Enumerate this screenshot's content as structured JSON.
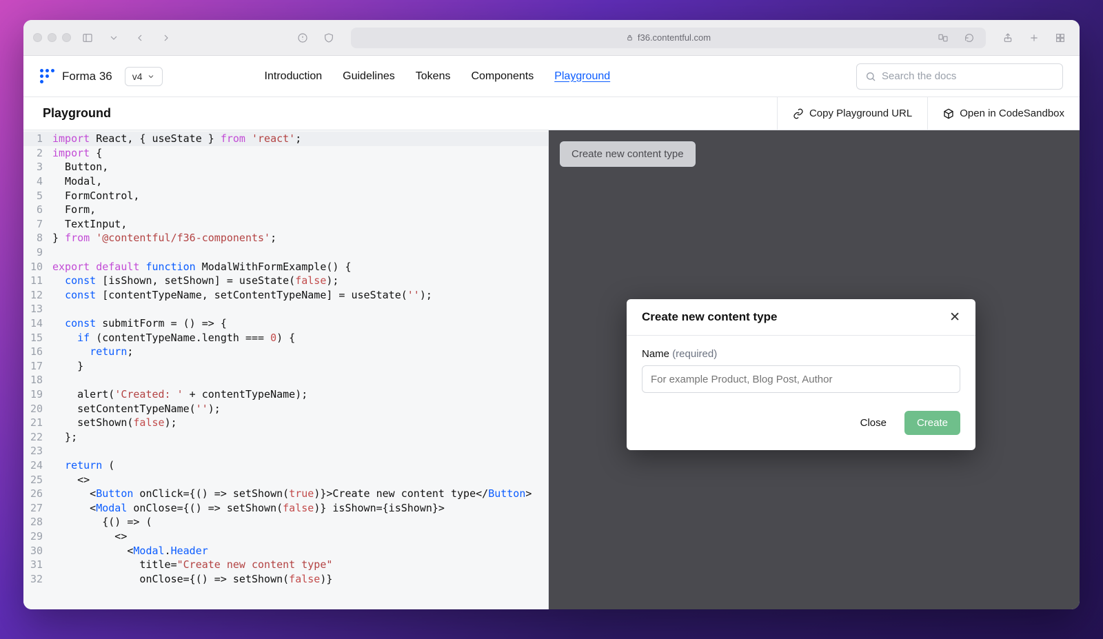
{
  "browser": {
    "address": "f36.contentful.com"
  },
  "header": {
    "brand": "Forma 36",
    "version": "v4",
    "nav": {
      "introduction": "Introduction",
      "guidelines": "Guidelines",
      "tokens": "Tokens",
      "components": "Components",
      "playground": "Playground"
    },
    "search_placeholder": "Search the docs"
  },
  "subbar": {
    "title": "Playground",
    "copy_url": "Copy Playground URL",
    "open_sandbox": "Open in CodeSandbox"
  },
  "editor": {
    "lines": [
      {
        "n": 1,
        "hl": true,
        "segs": [
          {
            "c": "k-imp",
            "t": "import"
          },
          {
            "t": " React, { useState } "
          },
          {
            "c": "k-imp",
            "t": "from"
          },
          {
            "t": " "
          },
          {
            "c": "k-str",
            "t": "'react'"
          },
          {
            "t": ";"
          }
        ]
      },
      {
        "n": 2,
        "segs": [
          {
            "c": "k-imp",
            "t": "import"
          },
          {
            "t": " {"
          }
        ]
      },
      {
        "n": 3,
        "segs": [
          {
            "t": "  Button,"
          }
        ]
      },
      {
        "n": 4,
        "segs": [
          {
            "t": "  Modal,"
          }
        ]
      },
      {
        "n": 5,
        "segs": [
          {
            "t": "  FormControl,"
          }
        ]
      },
      {
        "n": 6,
        "segs": [
          {
            "t": "  Form,"
          }
        ]
      },
      {
        "n": 7,
        "segs": [
          {
            "t": "  TextInput,"
          }
        ]
      },
      {
        "n": 8,
        "segs": [
          {
            "t": "} "
          },
          {
            "c": "k-imp",
            "t": "from"
          },
          {
            "t": " "
          },
          {
            "c": "k-str",
            "t": "'@contentful/f36-components'"
          },
          {
            "t": ";"
          }
        ]
      },
      {
        "n": 9,
        "segs": []
      },
      {
        "n": 10,
        "segs": [
          {
            "c": "k-imp",
            "t": "export"
          },
          {
            "t": " "
          },
          {
            "c": "k-imp",
            "t": "default"
          },
          {
            "t": " "
          },
          {
            "c": "k-blue",
            "t": "function"
          },
          {
            "t": " ModalWithFormExample() {"
          }
        ]
      },
      {
        "n": 11,
        "segs": [
          {
            "t": "  "
          },
          {
            "c": "k-blue",
            "t": "const"
          },
          {
            "t": " [isShown, setShown] = useState("
          },
          {
            "c": "k-red",
            "t": "false"
          },
          {
            "t": ");"
          }
        ]
      },
      {
        "n": 12,
        "segs": [
          {
            "t": "  "
          },
          {
            "c": "k-blue",
            "t": "const"
          },
          {
            "t": " [contentTypeName, setContentTypeName] = useState("
          },
          {
            "c": "k-str",
            "t": "''"
          },
          {
            "t": ");"
          }
        ]
      },
      {
        "n": 13,
        "segs": []
      },
      {
        "n": 14,
        "segs": [
          {
            "t": "  "
          },
          {
            "c": "k-blue",
            "t": "const"
          },
          {
            "t": " submitForm = () => {"
          }
        ]
      },
      {
        "n": 15,
        "segs": [
          {
            "t": "    "
          },
          {
            "c": "k-blue",
            "t": "if"
          },
          {
            "t": " (contentTypeName.length === "
          },
          {
            "c": "k-red",
            "t": "0"
          },
          {
            "t": ") {"
          }
        ]
      },
      {
        "n": 16,
        "segs": [
          {
            "t": "      "
          },
          {
            "c": "k-blue",
            "t": "return"
          },
          {
            "t": ";"
          }
        ]
      },
      {
        "n": 17,
        "segs": [
          {
            "t": "    }"
          }
        ]
      },
      {
        "n": 18,
        "segs": []
      },
      {
        "n": 19,
        "segs": [
          {
            "t": "    alert("
          },
          {
            "c": "k-str",
            "t": "'Created: '"
          },
          {
            "t": " + contentTypeName);"
          }
        ]
      },
      {
        "n": 20,
        "segs": [
          {
            "t": "    setContentTypeName("
          },
          {
            "c": "k-str",
            "t": "''"
          },
          {
            "t": ");"
          }
        ]
      },
      {
        "n": 21,
        "segs": [
          {
            "t": "    setShown("
          },
          {
            "c": "k-red",
            "t": "false"
          },
          {
            "t": ");"
          }
        ]
      },
      {
        "n": 22,
        "segs": [
          {
            "t": "  };"
          }
        ]
      },
      {
        "n": 23,
        "segs": []
      },
      {
        "n": 24,
        "segs": [
          {
            "t": "  "
          },
          {
            "c": "k-blue",
            "t": "return"
          },
          {
            "t": " ("
          }
        ]
      },
      {
        "n": 25,
        "segs": [
          {
            "t": "    <>"
          }
        ]
      },
      {
        "n": 26,
        "segs": [
          {
            "t": "      <"
          },
          {
            "c": "k-blue",
            "t": "Button"
          },
          {
            "t": " onClick={() => setShown("
          },
          {
            "c": "k-red",
            "t": "true"
          },
          {
            "t": ")}>Create new content type</"
          },
          {
            "c": "k-blue",
            "t": "Button"
          },
          {
            "t": ">"
          }
        ]
      },
      {
        "n": 27,
        "segs": [
          {
            "t": "      <"
          },
          {
            "c": "k-blue",
            "t": "Modal"
          },
          {
            "t": " onClose={() => setShown("
          },
          {
            "c": "k-red",
            "t": "false"
          },
          {
            "t": ")} isShown={isShown}>"
          }
        ]
      },
      {
        "n": 28,
        "segs": [
          {
            "t": "        {() => ("
          }
        ]
      },
      {
        "n": 29,
        "segs": [
          {
            "t": "          <>"
          }
        ]
      },
      {
        "n": 30,
        "segs": [
          {
            "t": "            <"
          },
          {
            "c": "k-blue",
            "t": "Modal"
          },
          {
            "t": "."
          },
          {
            "c": "k-blue",
            "t": "Header"
          }
        ]
      },
      {
        "n": 31,
        "segs": [
          {
            "t": "              title="
          },
          {
            "c": "k-str",
            "t": "\"Create new content type\""
          }
        ]
      },
      {
        "n": 32,
        "segs": [
          {
            "t": "              onClose={() => setShown("
          },
          {
            "c": "k-red",
            "t": "false"
          },
          {
            "t": ")}"
          }
        ]
      }
    ]
  },
  "preview": {
    "trigger_label": "Create new content type",
    "modal": {
      "title": "Create new content type",
      "field_label": "Name",
      "field_required": "(required)",
      "placeholder": "For example Product, Blog Post, Author",
      "close": "Close",
      "create": "Create"
    }
  }
}
